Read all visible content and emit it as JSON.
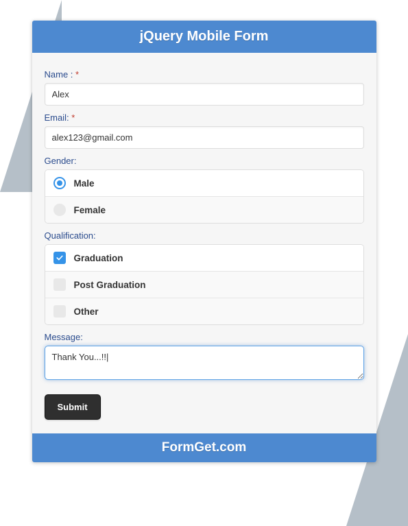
{
  "header": {
    "title": "jQuery Mobile Form"
  },
  "footer": {
    "text": "FormGet.com"
  },
  "form": {
    "name": {
      "label": "Name :",
      "required": "*",
      "value": "Alex"
    },
    "email": {
      "label": "Email:",
      "required": "*",
      "value": "alex123@gmail.com"
    },
    "gender": {
      "label": "Gender:",
      "options": [
        {
          "label": "Male",
          "selected": true
        },
        {
          "label": "Female",
          "selected": false
        }
      ]
    },
    "qualification": {
      "label": "Qualification:",
      "options": [
        {
          "label": "Graduation",
          "checked": true
        },
        {
          "label": "Post Graduation",
          "checked": false
        },
        {
          "label": "Other",
          "checked": false
        }
      ]
    },
    "message": {
      "label": "Message:",
      "value": "Thank You...!!|"
    },
    "submit": {
      "label": "Submit"
    }
  }
}
